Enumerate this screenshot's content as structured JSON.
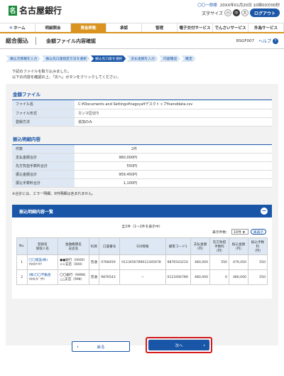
{
  "header": {
    "bank_name": "名古屋銀行",
    "logo_mark": "名",
    "user_name": "〇〇一郎様",
    "last_login": "20XX年01月20日 10時00分00秒",
    "text_size_label": "文字サイズ",
    "size_options": [
      "小",
      "中",
      "大"
    ],
    "logout_label": "ログアウト"
  },
  "nav": {
    "items": [
      "ホーム",
      "明細照会",
      "資金移動",
      "承認",
      "管理",
      "電子交付サービス",
      "でんさいサービス",
      "外為サービス"
    ],
    "home_icon": "house-icon"
  },
  "title": {
    "main": "総合振込",
    "sub": "金額ファイル内容確認",
    "screen_id": "BSGF007",
    "help_label": "ヘルプ",
    "help_mark": "?"
  },
  "steps": [
    "振込元情報を入力",
    "振込先口座指定方法を選択",
    "振込先口座を選択",
    "支払金額を入力",
    "内容確認",
    "確定"
  ],
  "intro": {
    "line1": "下記のファイルを取り込みました。",
    "line2": "以下の内容を確認の上、「次へ」ボタンをクリックしてください。"
  },
  "file_section": {
    "title": "金額ファイル",
    "rows": [
      {
        "label": "ファイル名",
        "value": "C:¥Documents and Settings¥nagoya¥デスクトップ¥senddata.csv"
      },
      {
        "label": "ファイル形式",
        "value": "カンマ区切り"
      },
      {
        "label": "登録方法",
        "value": "追加のみ"
      }
    ]
  },
  "summary_section": {
    "title": "振込明細内容",
    "rows": [
      {
        "label": "件数",
        "value": "2件"
      },
      {
        "label": "支払金額合計",
        "value": "960,000円"
      },
      {
        "label": "先方負担手数料合計",
        "value": "550円"
      },
      {
        "label": "振込金額合計",
        "value": "959,450円"
      },
      {
        "label": "振込手数料合計",
        "value": "1,100円"
      }
    ],
    "note": "※合計には、エラー明細、0円明細は含まれません。"
  },
  "detail": {
    "title": "振込明細内容一覧",
    "collapse_symbol": "−",
    "count_text": "全2件（1〜2件を表示中）",
    "per_page_label": "表示件数：",
    "per_page_value": "10件",
    "redisplay_label": "再表示",
    "columns": [
      "No.",
      "登録名\n受取人名",
      "金融機関名\n支店名",
      "科目",
      "口座番号",
      "EDI情報",
      "顧客コード1",
      "支払金額\n（円）",
      "先方負担\n手数料\n（円）",
      "振込金額\n（円）",
      "振込手数\n料\n（円）"
    ],
    "rows": [
      {
        "no": "1",
        "name1": "〇〇建設(株)",
        "name2": "ﾏﾙﾏﾙｹﾝｾﾂ",
        "bank1": "●●銀行（0000）",
        "bank2": "××支店（000）",
        "type": "普通",
        "account": "0768459",
        "edi": "0123456789012345678",
        "cust": "9876543210",
        "pay": "480,000",
        "fee": "550",
        "transfer": "479,450",
        "tfee": "550"
      },
      {
        "no": "2",
        "name1": "(株)〇〇不動産",
        "name2": "ﾏﾙﾏﾙﾌﾄﾞｳｻﾝ",
        "bank1": "〇〇銀行（9998）",
        "bank2": "△△支店（998）",
        "type": "普通",
        "account": "9876543",
        "edi": "−",
        "cust": "0123456789",
        "pay": "480,000",
        "fee": "0",
        "transfer": "480,000",
        "tfee": "550"
      }
    ]
  },
  "buttons": {
    "back_label": "戻る",
    "next_label": "次へ"
  },
  "colors": {
    "brand_blue": "#1a56a8",
    "nav_active": "#d9931e",
    "highlight_red": "#d61b1b",
    "logo_green": "#1b8a3a"
  }
}
